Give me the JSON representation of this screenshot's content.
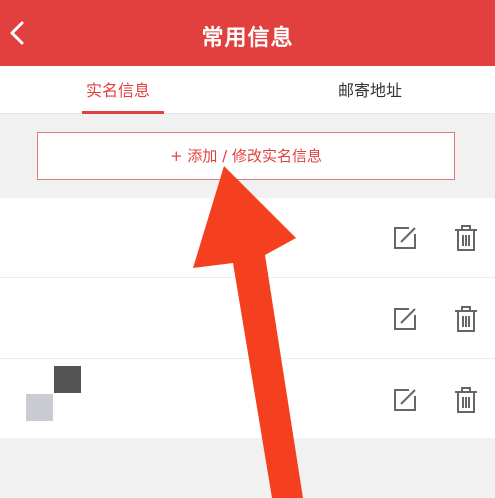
{
  "header": {
    "title": "常用信息",
    "back_icon": "chevron-left-icon",
    "color": "#e23f3f"
  },
  "tabs": [
    {
      "label": "实名信息",
      "active": true
    },
    {
      "label": "邮寄地址",
      "active": false
    }
  ],
  "add_button": {
    "label": "+ 添加 / 修改实名信息"
  },
  "list": {
    "rows": [
      {
        "edit_icon": "edit-icon",
        "delete_icon": "trash-icon"
      },
      {
        "edit_icon": "edit-icon",
        "delete_icon": "trash-icon"
      },
      {
        "edit_icon": "edit-icon",
        "delete_icon": "trash-icon"
      }
    ]
  },
  "colors": {
    "accent": "#e23f3f",
    "arrow": "#f4401e",
    "background": "#f1f1f1"
  }
}
